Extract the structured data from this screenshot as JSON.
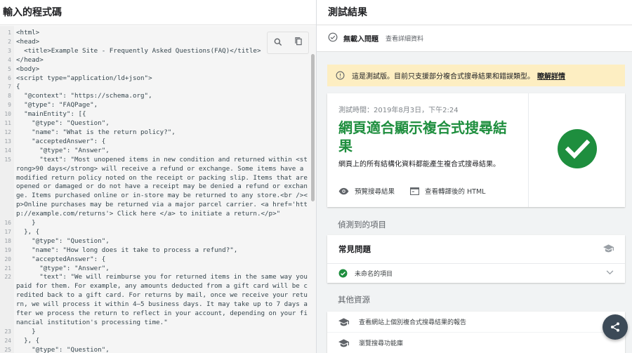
{
  "left_title": "輸入的程式碼",
  "code_lines": [
    {
      "n": "1",
      "t": "<html>"
    },
    {
      "n": "2",
      "t": "<head>"
    },
    {
      "n": "3",
      "t": "  <title>Example Site - Frequently Asked Questions(FAQ)</title>"
    },
    {
      "n": "4",
      "t": "</head>"
    },
    {
      "n": "5",
      "t": "<body>"
    },
    {
      "n": "6",
      "t": "<script type=\"application/ld+json\">"
    },
    {
      "n": "7",
      "t": "{"
    },
    {
      "n": "8",
      "t": "  \"@context\": \"https://schema.org\","
    },
    {
      "n": "9",
      "t": "  \"@type\": \"FAQPage\","
    },
    {
      "n": "10",
      "t": "  \"mainEntity\": [{"
    },
    {
      "n": "11",
      "t": "    \"@type\": \"Question\","
    },
    {
      "n": "12",
      "t": "    \"name\": \"What is the return policy?\","
    },
    {
      "n": "13",
      "t": "    \"acceptedAnswer\": {"
    },
    {
      "n": "14",
      "t": "      \"@type\": \"Answer\","
    },
    {
      "n": "15",
      "t": "      \"text\": \"Most unopened items in new condition and returned within <strong>90 days</strong> will receive a refund or exchange. Some items have a modified return policy noted on the receipt or packing slip. Items that are opened or damaged or do not have a receipt may be denied a refund or exchange. Items purchased online or in-store may be returned to any store.<br /><p>Online purchases may be returned via a major parcel carrier. <a href='http://example.com/returns'> Click here </a> to initiate a return.</p>\""
    },
    {
      "n": "16",
      "t": "    }"
    },
    {
      "n": "17",
      "t": "  }, {"
    },
    {
      "n": "18",
      "t": "    \"@type\": \"Question\","
    },
    {
      "n": "19",
      "t": "    \"name\": \"How long does it take to process a refund?\","
    },
    {
      "n": "20",
      "t": "    \"acceptedAnswer\": {"
    },
    {
      "n": "21",
      "t": "      \"@type\": \"Answer\","
    },
    {
      "n": "22",
      "t": "      \"text\": \"We will reimburse you for returned items in the same way you paid for them. For example, any amounts deducted from a gift card will be credited back to a gift card. For returns by mail, once we receive your return, we will process it within 4–5 business days. It may take up to 7 days after we process the return to reflect in your account, depending on your financial institution's processing time.\""
    },
    {
      "n": "23",
      "t": "    }"
    },
    {
      "n": "24",
      "t": "  }, {"
    },
    {
      "n": "25",
      "t": "    \"@type\": \"Question\","
    }
  ],
  "right_title": "測試結果",
  "issues": {
    "label": "無載入問題",
    "link": "查看詳細資料"
  },
  "warning": {
    "text": "這是測試版。目前只支援部分複合式搜尋結果和錯誤類型。",
    "link": "瞭解詳情"
  },
  "result": {
    "test_time": "測試時間：2019年8月3日，下午2:24",
    "verdict": "網頁適合顯示複合式搜尋結果",
    "description": "網頁上的所有結構化資料都能產生複合式搜尋結果。",
    "preview_label": "預覽搜尋結果",
    "html_label": "查看轉譯後的 HTML"
  },
  "detected_title": "偵測到的項目",
  "faq": {
    "title": "常見問題",
    "item": "未命名的項目"
  },
  "resources_title": "其他資源",
  "resources": [
    "查看網站上個別複合式搜尋結果的報告",
    "瀏覽搜尋功能庫"
  ],
  "colors": {
    "success": "#1e8e3e",
    "warning_bg": "#fdeec2"
  }
}
